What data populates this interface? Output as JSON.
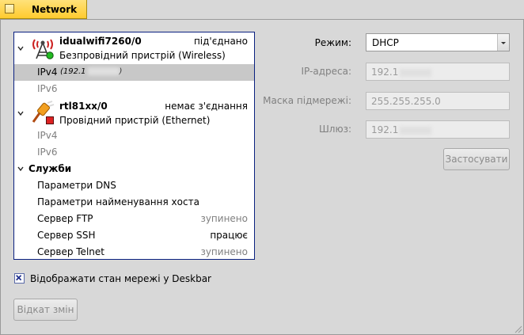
{
  "window": {
    "title": "Network"
  },
  "interfaces": [
    {
      "name": "idualwifi7260/0",
      "status": "під'єднано",
      "type": "Безпровідний пристрій (Wireless)",
      "status_color": "#22bb22",
      "protocols": [
        {
          "label": "IPv4",
          "detail": "(192.1",
          "selected": true
        },
        {
          "label": "IPv6",
          "detail": "",
          "selected": false
        }
      ]
    },
    {
      "name": "rtl81xx/0",
      "status": "немає з'єднання",
      "type": "Провідний пристрій (Ethernet)",
      "status_color": "#dd2222",
      "protocols": [
        {
          "label": "IPv4",
          "detail": "",
          "selected": false
        },
        {
          "label": "IPv6",
          "detail": "",
          "selected": false
        }
      ]
    }
  ],
  "services": {
    "header": "Служби",
    "items": [
      {
        "label": "Параметри DNS",
        "status": ""
      },
      {
        "label": "Параметри найменування хоста",
        "status": ""
      },
      {
        "label": "Сервер FTP",
        "status": "зупинено"
      },
      {
        "label": "Сервер SSH",
        "status": "працює"
      },
      {
        "label": "Сервер Telnet",
        "status": "зупинено"
      }
    ]
  },
  "settings": {
    "mode_label": "Режим:",
    "mode_value": "DHCP",
    "ip_label": "IP-адреса:",
    "ip_value": "192.1",
    "mask_label": "Маска підмережі:",
    "mask_value": "255.255.255.0",
    "gateway_label": "Шлюз:",
    "gateway_value": "192.1",
    "apply_button": "Застосувати"
  },
  "deskbar_checkbox": {
    "label": "Відображати стан мережі у Deskbar",
    "checked": true
  },
  "revert_button": "Відкат змін",
  "accent_color": "#ffcb2e",
  "list_border_color": "#0a2080"
}
